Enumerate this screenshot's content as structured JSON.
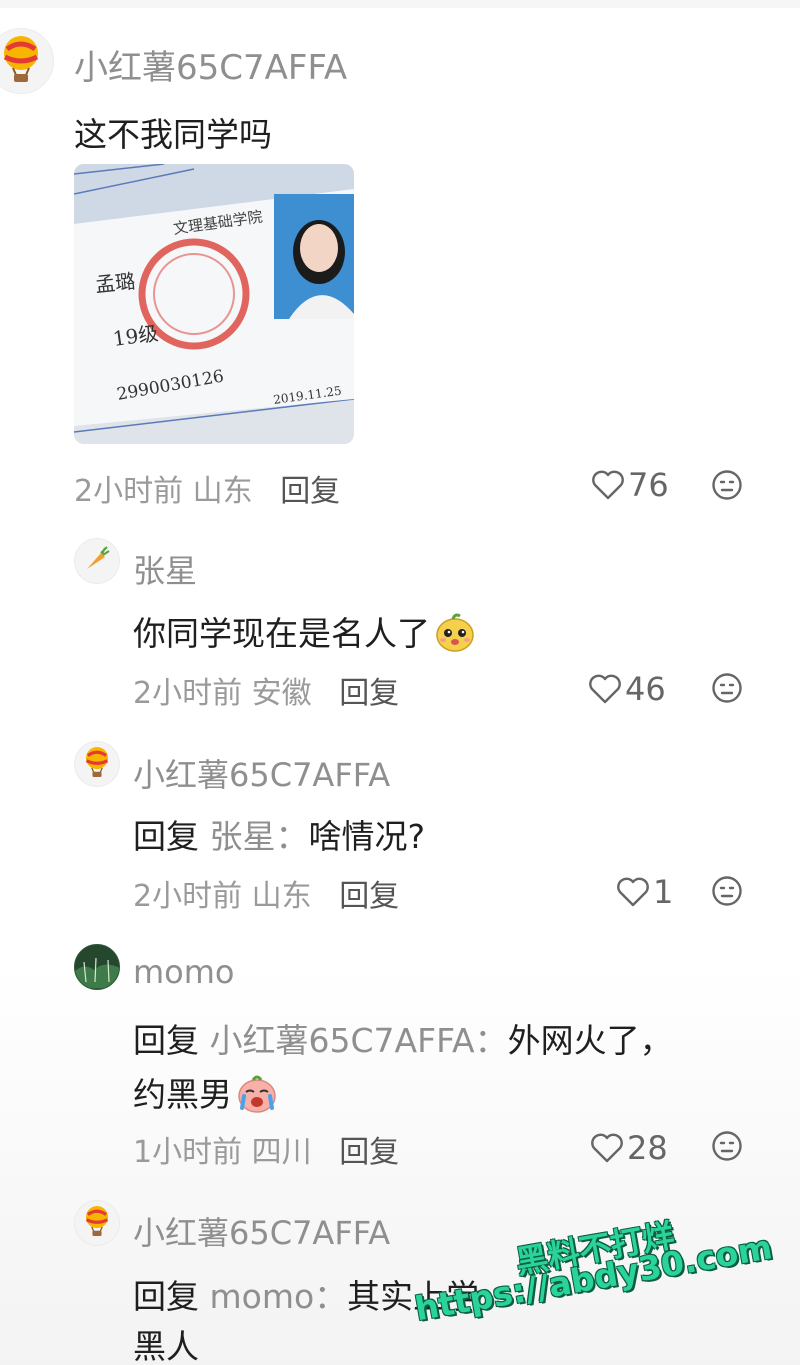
{
  "comments": [
    {
      "user": "小红薯65C7AFFA",
      "text": "这不我同学吗",
      "time": "2小时前",
      "location": "山东",
      "reply_label": "回复",
      "likes": "76"
    },
    {
      "user": "张星",
      "text": "你同学现在是名人了",
      "time": "2小时前",
      "location": "安徽",
      "reply_label": "回复",
      "likes": "46"
    },
    {
      "user": "小红薯65C7AFFA",
      "reply_prefix": "回复",
      "reply_to": "张星：",
      "text": "啥情况?",
      "time": "2小时前",
      "location": "山东",
      "reply_label": "回复",
      "likes": "1"
    },
    {
      "user": "momo",
      "reply_prefix": "回复",
      "reply_to": "小红薯65C7AFFA：",
      "text": "外网火了，",
      "text_line2": "约黑男",
      "time": "1小时前",
      "location": "四川",
      "reply_label": "回复",
      "likes": "28"
    },
    {
      "user": "小红薯65C7AFFA",
      "reply_prefix": "回复",
      "reply_to": "momo：",
      "text": "其实上学",
      "text_line2": "黑人"
    }
  ],
  "photo": {
    "handwriting_1": "孟璐",
    "handwriting_2": "19级",
    "handwriting_3": "2990030126",
    "date": "2019.11.25",
    "header": "文理基础学院"
  },
  "watermark": {
    "line1": "黑料不打烊",
    "line2": "https://abdy30.com"
  },
  "colors": {
    "username": "#8f8f8f",
    "meta": "#9a9a9a",
    "watermark": "#29d39a"
  },
  "icons": [
    "balloon-avatar-icon",
    "carrot-avatar-icon",
    "forest-avatar-icon",
    "heart-icon",
    "dislike-face-icon",
    "lemon-emoji-icon",
    "crying-emoji-icon"
  ]
}
